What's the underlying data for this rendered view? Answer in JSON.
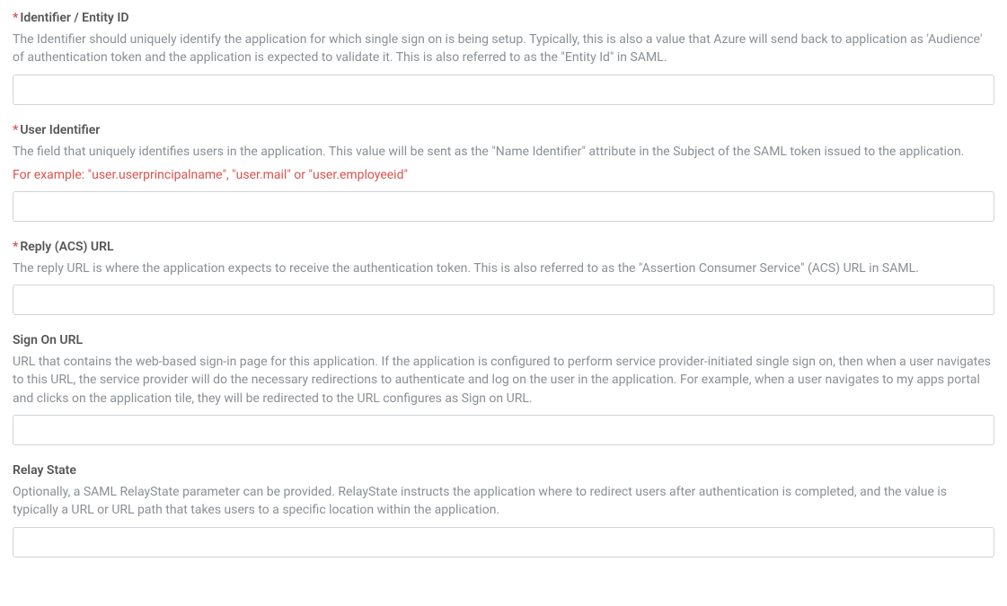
{
  "fields": {
    "identifier": {
      "required": true,
      "label": "Identifier / Entity ID",
      "description": "The Identifier should uniquely identify the application for which single sign on is being setup. Typically, this is also a value that Azure will send back to application as 'Audience' of authentication token and the application is expected to validate it. This is also referred to as the \"Entity Id\" in SAML.",
      "value": ""
    },
    "userIdentifier": {
      "required": true,
      "label": "User Identifier",
      "description": "The field that uniquely identifies users in the application. This value will be sent as the \"Name Identifier\" attribute in the Subject of the SAML token issued to the application.",
      "example": "For example: \"user.userprincipalname\", \"user.mail\" or \"user.employeeid\"",
      "value": ""
    },
    "replyUrl": {
      "required": true,
      "label": "Reply (ACS) URL",
      "description": "The reply URL is where the application expects to receive the authentication token. This is also referred to as the \"Assertion Consumer Service\" (ACS) URL in SAML.",
      "value": ""
    },
    "signOnUrl": {
      "required": false,
      "label": "Sign On URL",
      "description": "URL that contains the web-based sign-in page for this application. If the application is configured to perform service provider-initiated single sign on, then when a user navigates to this URL, the service provider will do the necessary redirections to authenticate and log on the user in the application. For example, when a user navigates to my apps portal and clicks on the application tile, they will be redirected to the URL configures as Sign on URL.",
      "value": ""
    },
    "relayState": {
      "required": false,
      "label": "Relay State",
      "description": "Optionally, a SAML RelayState parameter can be provided. RelayState instructs the application where to redirect users after authentication is completed, and the value is typically a URL or URL path that takes users to a specific location within the application.",
      "value": ""
    }
  },
  "requiredMarker": "*"
}
